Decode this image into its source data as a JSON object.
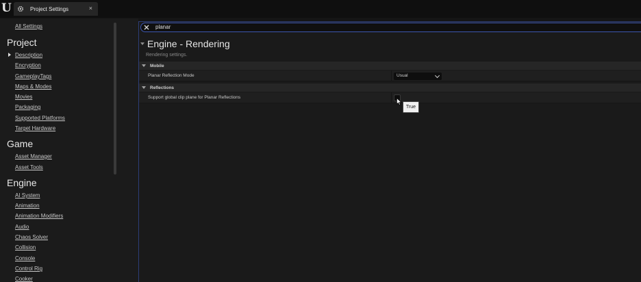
{
  "titlebar": {
    "logo": "U",
    "tab": {
      "label": "Project Settings",
      "icon": "gear-icon",
      "close": "×"
    }
  },
  "sidebar": {
    "all_settings": "All Settings",
    "sections": [
      {
        "title": "Project",
        "items": [
          "Description",
          "Encryption",
          "GameplayTags",
          "Maps & Modes",
          "Movies",
          "Packaging",
          "Supported Platforms",
          "Target Hardware"
        ]
      },
      {
        "title": "Game",
        "items": [
          "Asset Manager",
          "Asset Tools"
        ]
      },
      {
        "title": "Engine",
        "items": [
          "AI System",
          "Animation",
          "Animation Modifiers",
          "Audio",
          "Chaos Solver",
          "Collision",
          "Console",
          "Control Rig",
          "Cooker"
        ]
      }
    ],
    "selected": "Description"
  },
  "search": {
    "value": "planar",
    "icon": "close-icon"
  },
  "panel": {
    "title": "Engine - Rendering",
    "subtitle": "Rendering settings.",
    "categories": [
      {
        "label": "Mobile",
        "rows": [
          {
            "label": "Planar Reflection Mode",
            "value": "Usual"
          }
        ]
      },
      {
        "label": "Reflections",
        "rows": [
          {
            "label": "Support global clip plane for Planar Reflections",
            "value": ""
          }
        ]
      }
    ]
  },
  "tooltip": "True",
  "colors": {
    "accent": "#3d57b0",
    "background": "#151515",
    "panel": "#1a1a1a"
  }
}
